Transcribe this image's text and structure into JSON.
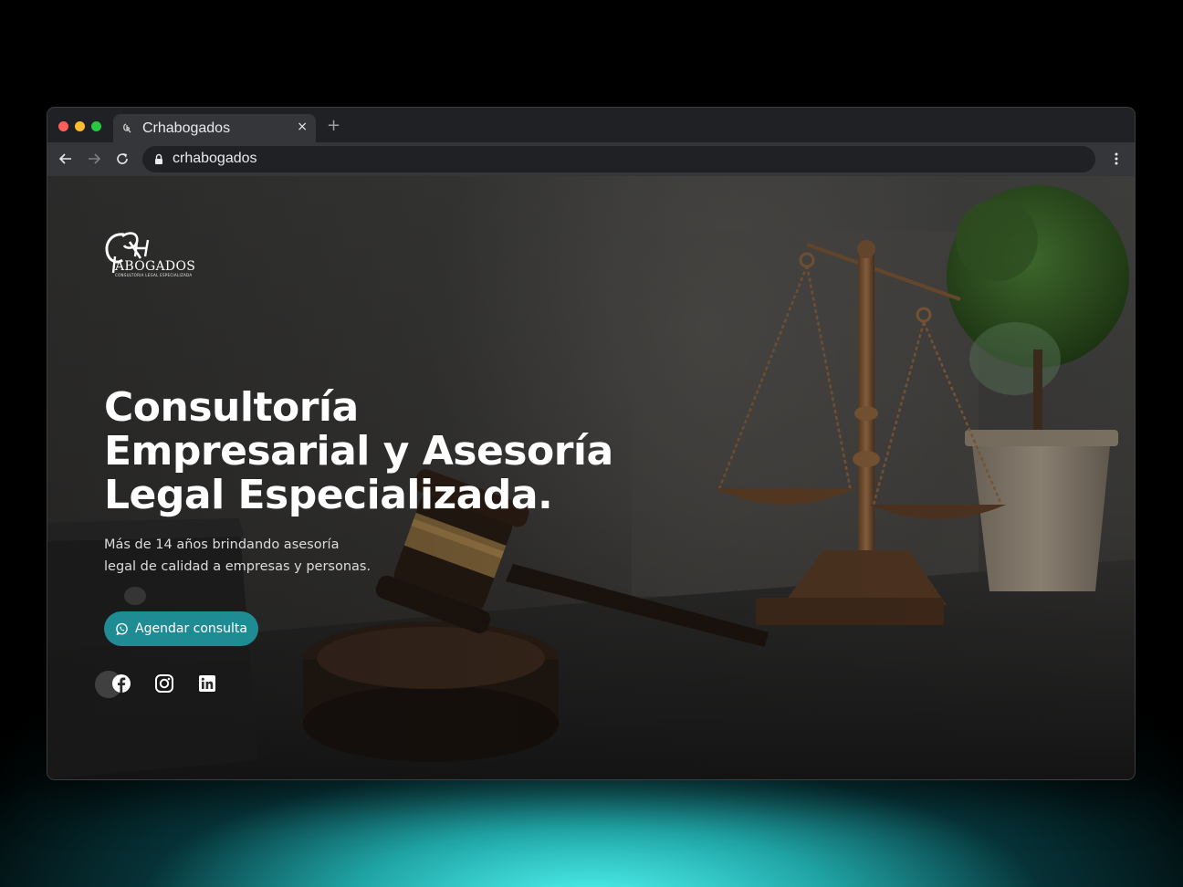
{
  "browser": {
    "tab_title": "Crhabogados",
    "tab_close": "×",
    "new_tab": "+",
    "url": "crhabogados"
  },
  "site": {
    "logo_monogram": "CRH",
    "logo_text": "ABOGADOS",
    "logo_tagline": "CONSULTORIA LEGAL ESPECIALIZADA",
    "headline_line1": "Consultoría",
    "headline_line2": "Empresarial y Asesoría",
    "headline_line3": "Legal Especializada.",
    "subtext_line1": "Más de 14 años brindando asesoría",
    "subtext_line2": "legal de calidad a empresas y personas.",
    "cta_label": "Agendar consulta",
    "cta_icon": "whatsapp-icon",
    "social_icons": [
      "facebook-icon",
      "instagram-icon",
      "linkedin-icon"
    ]
  },
  "colors": {
    "accent": "#1f8c94",
    "glow": "#50f5f0",
    "chrome_dark": "#202124",
    "chrome_light": "#35363a"
  }
}
